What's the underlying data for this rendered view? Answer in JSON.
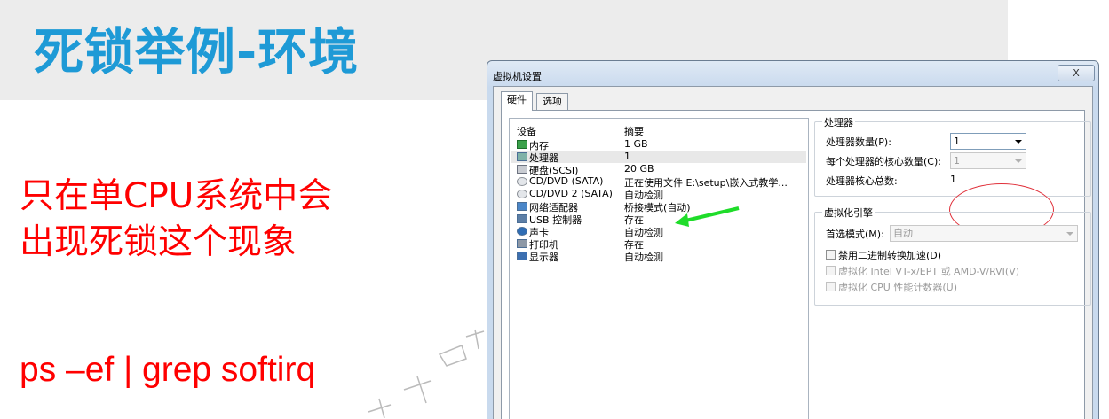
{
  "slide": {
    "title": "死锁举例-环境",
    "line1": "只在单CPU系统中会",
    "line2": "出现死锁这个现象",
    "command": "ps –ef | grep softirq",
    "accent": "#1e9ad6",
    "text_color": "#ff0000"
  },
  "dialog": {
    "title": "虚拟机设置",
    "close_label": "X",
    "tabs": [
      {
        "label": "硬件",
        "active": true
      },
      {
        "label": "选项",
        "active": false
      }
    ],
    "columns": {
      "device": "设备",
      "summary": "摘要"
    },
    "devices": [
      {
        "icon": "memory-icon",
        "name": "内存",
        "summary": "1 GB"
      },
      {
        "icon": "processor-icon",
        "name": "处理器",
        "summary": "1",
        "selected": true
      },
      {
        "icon": "hard-disk-icon",
        "name": "硬盘(SCSI)",
        "summary": "20 GB"
      },
      {
        "icon": "cd-dvd-icon",
        "name": "CD/DVD (SATA)",
        "summary": "正在使用文件 E:\\setup\\嵌入式教学..."
      },
      {
        "icon": "cd-dvd-icon",
        "name": "CD/DVD 2 (SATA)",
        "summary": "自动检测"
      },
      {
        "icon": "network-icon",
        "name": "网络适配器",
        "summary": "桥接模式(自动)"
      },
      {
        "icon": "usb-icon",
        "name": "USB 控制器",
        "summary": "存在"
      },
      {
        "icon": "sound-icon",
        "name": "声卡",
        "summary": "自动检测"
      },
      {
        "icon": "printer-icon",
        "name": "打印机",
        "summary": "存在"
      },
      {
        "icon": "display-icon",
        "name": "显示器",
        "summary": "自动检测"
      }
    ],
    "processor": {
      "group_label": "处理器",
      "count_label": "处理器数量(P):",
      "count_value": "1",
      "cores_label": "每个处理器的核心数量(C):",
      "cores_value": "1",
      "total_label": "处理器核心总数:",
      "total_value": "1"
    },
    "virtualization": {
      "group_label": "虚拟化引擎",
      "mode_label": "首选模式(M):",
      "mode_value": "自动",
      "options": [
        {
          "label": "禁用二进制转换加速(D)",
          "enabled": true
        },
        {
          "label": "虚拟化 Intel VT-x/EPT 或 AMD-V/RVI(V)",
          "enabled": false
        },
        {
          "label": "虚拟化 CPU 性能计数器(U)",
          "enabled": false
        }
      ]
    }
  }
}
